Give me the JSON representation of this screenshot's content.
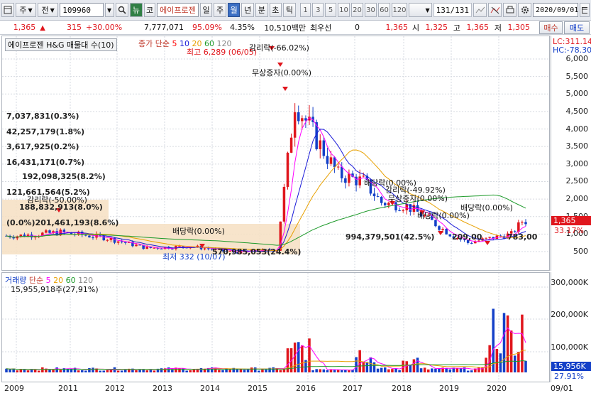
{
  "toolbar": {
    "period_type": "주",
    "market": "전",
    "code": "109960",
    "news_label": "뉴",
    "name_prefix": "코",
    "stock_name": "에이프로젠",
    "periods": [
      "일",
      "주",
      "월",
      "년",
      "분",
      "초",
      "틱"
    ],
    "active_period": "월",
    "intervals": [
      "1",
      "3",
      "5",
      "10",
      "20",
      "30",
      "60",
      "120"
    ],
    "count": "131",
    "total": "/131",
    "date": "2020/09/01"
  },
  "quote": {
    "price": "1,365",
    "change": "315",
    "change_pct": "+30.00%",
    "volume": "7,777,071",
    "vol_ratio": "95.09%",
    "turnover": "4.35%",
    "amount": "10,510백만",
    "priority_label": "최우선",
    "priority_value": "0",
    "last": "1,365",
    "open_label": "시",
    "open": "1,325",
    "high_label": "고",
    "high": "1,365",
    "low_label": "저",
    "low": "1,305",
    "buy_label": "매수",
    "sell_label": "매도"
  },
  "price_pane": {
    "title": "에이프로젠 H&G 매물대 수(10)",
    "legend_label": "종가 단순",
    "ma": [
      {
        "period": "5",
        "color": "#ff0000"
      },
      {
        "period": "10",
        "color": "#1a1ad8"
      },
      {
        "period": "20",
        "color": "#e8a000"
      },
      {
        "period": "60",
        "color": "#1d9a2a"
      },
      {
        "period": "120",
        "color": "#888888"
      }
    ],
    "lc": "LC:311.14",
    "hc": "HC:-78.30",
    "current_tag": "1,365",
    "change_tag": "33.17%",
    "high_note": "최고 6,289 (06/05)",
    "low_note": "최저 332 (10/07)",
    "y_labels": [
      "6,000",
      "5,500",
      "5,000",
      "4,500",
      "4,000",
      "3,500",
      "3,000",
      "2,500",
      "2,000",
      "1,500",
      "1,000",
      "500"
    ],
    "annotations": [
      "감리락(-66.02%)",
      "무상증자(0.00%)",
      "감리락(-50.00%)",
      "배당락(0.00%)",
      "배당락(0.00%)",
      "감리락(-49.92%)",
      "무상증자(0.00%)",
      "배당락(0.00%)",
      "배당락(0.00%)"
    ],
    "volume_profile": [
      "7,037,831(0.3%)",
      "42,257,179(1.8%)",
      "3,617,925(0.2%)",
      "16,431,171(0.7%)",
      "192,098,325(8.2%)",
      "121,661,564(5.2%)",
      "188,832,913(8.0%)",
      "(0.0%)201,461,193(8.6%)",
      "994,379,501(42.5%)",
      "570,985,053(24.4%)",
      "209,00",
      "783,00"
    ]
  },
  "volume_pane": {
    "title": "거래량",
    "legend_label": "단순",
    "ma": [
      {
        "period": "5",
        "color": "#ff00ff"
      },
      {
        "period": "20",
        "color": "#e8a000"
      },
      {
        "period": "60",
        "color": "#1d9a2a"
      },
      {
        "period": "120",
        "color": "#888888"
      }
    ],
    "value": "15,955,918주(27,91%)",
    "y_labels": [
      "300,000K",
      "200,000K",
      "100,000K"
    ],
    "current_tag": "15,956K",
    "pct_tag": "27.91%"
  },
  "x_axis": [
    "2009",
    "2011",
    "2012",
    "2013",
    "2014",
    "2015",
    "2016",
    "2017",
    "2018",
    "2019",
    "2020",
    "09/01"
  ],
  "chart_data": {
    "type": "candlestick",
    "title": "에이프로젠 H&G 매물대 수(10)",
    "frequency": "월",
    "y_axis": {
      "min": 0,
      "max": 6000,
      "ticks": [
        500,
        1000,
        1500,
        2000,
        2500,
        3000,
        3500,
        4000,
        4500,
        5000,
        5500,
        6000
      ]
    },
    "x_ticks": [
      "2009",
      "2011",
      "2012",
      "2013",
      "2014",
      "2015",
      "2016",
      "2017",
      "2018",
      "2019",
      "2020",
      "09/01"
    ],
    "close_series": [
      {
        "x": "2009",
        "close": 950
      },
      {
        "x": "2010",
        "close": 1050
      },
      {
        "x": "2011",
        "close": 900
      },
      {
        "x": "2012",
        "close": 600
      },
      {
        "x": "2013",
        "close": 650
      },
      {
        "x": "2014",
        "close": 480
      },
      {
        "x": "2015-01",
        "close": 550
      },
      {
        "x": "2015-06",
        "close": 4800
      },
      {
        "x": "2015-12",
        "close": 3700
      },
      {
        "x": "2016-06",
        "close": 2700
      },
      {
        "x": "2017-01",
        "close": 2500
      },
      {
        "x": "2017-06",
        "close": 1900
      },
      {
        "x": "2018-01",
        "close": 1800
      },
      {
        "x": "2018-06",
        "close": 1500
      },
      {
        "x": "2019-01",
        "close": 1000
      },
      {
        "x": "2019-06",
        "close": 750
      },
      {
        "x": "2020-01",
        "close": 900
      },
      {
        "x": "2020-06",
        "close": 1000
      },
      {
        "x": "2020-09",
        "close": 1365
      }
    ],
    "high": 6289,
    "low": 332,
    "volume_axis": {
      "ticks": [
        100000,
        200000,
        300000
      ],
      "unit": "K"
    }
  }
}
